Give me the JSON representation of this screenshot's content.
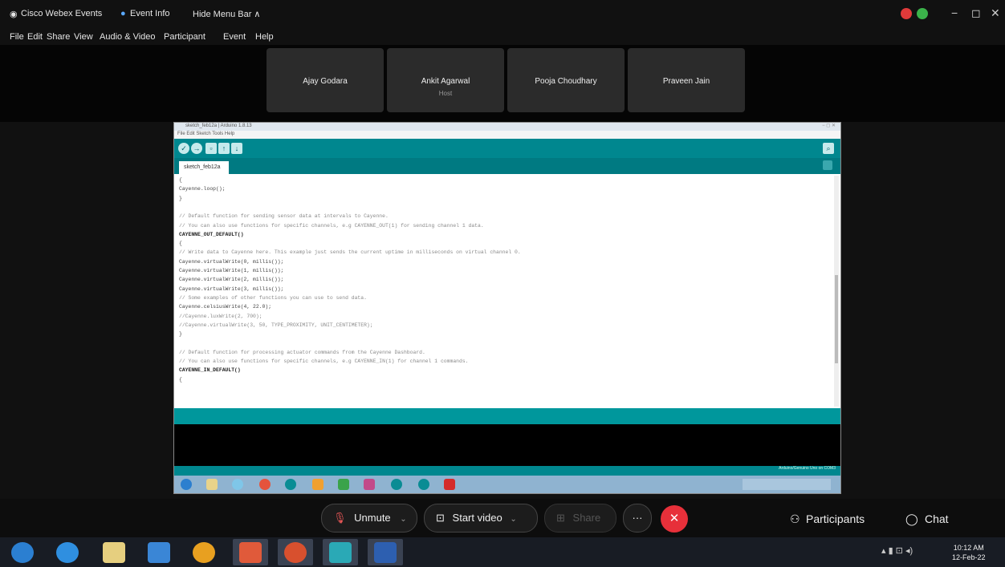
{
  "app": {
    "title": "Cisco Webex Events",
    "event_info": "Event Info",
    "hide_menu": "Hide Menu Bar ∧"
  },
  "menu": [
    "File",
    "Edit",
    "Share",
    "View",
    "Audio & Video",
    "Participant",
    "Event",
    "Help"
  ],
  "window_controls": {
    "minimize": "−",
    "restore": "◻",
    "close": "✕"
  },
  "participants": [
    {
      "name": "Ajay Godara",
      "role": ""
    },
    {
      "name": "Ankit Agarwal",
      "role": "Host"
    },
    {
      "name": "Pooja Choudhary",
      "role": ""
    },
    {
      "name": "Praveen Jain",
      "role": ""
    }
  ],
  "arduino": {
    "window_title": "sketch_feb12a | Arduino 1.8.13",
    "menu": "File  Edit  Sketch  Tools  Help",
    "tab": "sketch_feb12a",
    "footer": "Arduino/Genuino Uno on COM3",
    "code_lines": [
      {
        "t": "{",
        "c": "cl"
      },
      {
        "t": "  Cayenne.loop();",
        "c": "cl"
      },
      {
        "t": "}",
        "c": "cl"
      },
      {
        "t": "",
        "c": "cl"
      },
      {
        "t": "// Default function for sending sensor data at intervals to Cayenne.",
        "c": "cl cm"
      },
      {
        "t": "// You can also use functions for specific channels, e.g CAYENNE_OUT(1) for sending channel 1 data.",
        "c": "cl cm"
      },
      {
        "t": "CAYENNE_OUT_DEFAULT()",
        "c": "cl fn"
      },
      {
        "t": "{",
        "c": "cl"
      },
      {
        "t": "  // Write data to Cayenne here. This example just sends the current uptime in milliseconds on virtual channel 0.",
        "c": "cl cm"
      },
      {
        "t": "  Cayenne.virtualWrite(0, millis());",
        "c": "cl"
      },
      {
        "t": "  Cayenne.virtualWrite(1, millis());",
        "c": "cl"
      },
      {
        "t": "  Cayenne.virtualWrite(2, millis());",
        "c": "cl"
      },
      {
        "t": "  Cayenne.virtualWrite(3, millis());",
        "c": "cl"
      },
      {
        "t": "  // Some examples of other functions you can use to send data.",
        "c": "cl cm"
      },
      {
        "t": "  Cayenne.celsiusWrite(4, 22.0);",
        "c": "cl"
      },
      {
        "t": "  //Cayenne.luxWrite(2, 700);",
        "c": "cl cm"
      },
      {
        "t": "  //Cayenne.virtualWrite(3, 50, TYPE_PROXIMITY, UNIT_CENTIMETER);",
        "c": "cl cm"
      },
      {
        "t": "}",
        "c": "cl"
      },
      {
        "t": "",
        "c": "cl"
      },
      {
        "t": "// Default function for processing actuator commands from the Cayenne Dashboard.",
        "c": "cl cm"
      },
      {
        "t": "// You can also use functions for specific channels, e.g CAYENNE_IN(1) for channel 1 commands.",
        "c": "cl cm"
      },
      {
        "t": "CAYENNE_IN_DEFAULT()",
        "c": "cl fn"
      },
      {
        "t": "{",
        "c": "cl"
      }
    ]
  },
  "controls": {
    "unmute": "Unmute",
    "start_video": "Start video",
    "share": "Share",
    "more": "···",
    "end": "✕",
    "participants": "Participants",
    "chat": "Chat"
  },
  "taskbar": {
    "time": "10:12 AM",
    "date": "12-Feb-22"
  },
  "colors": {
    "arduino_teal": "#00878f",
    "end_red": "#e7303a"
  }
}
